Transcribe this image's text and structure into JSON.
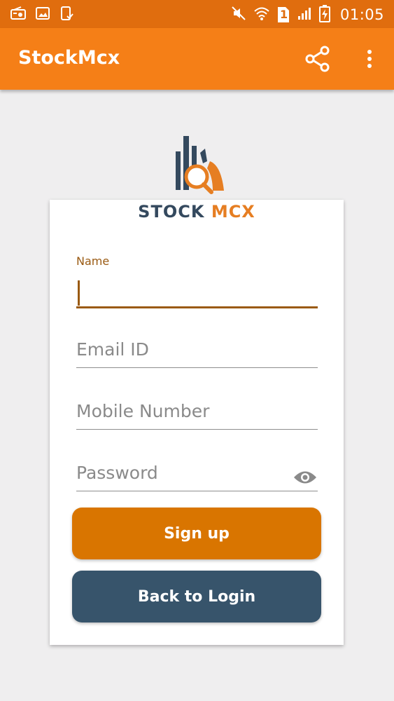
{
  "status_bar": {
    "time": "01:05",
    "sim_slot": "1",
    "icons": [
      "radio-icon",
      "image-icon",
      "phone-check-icon",
      "mute-icon",
      "wifi-icon",
      "sim-icon",
      "signal-icon",
      "battery-charging-icon"
    ]
  },
  "toolbar": {
    "title": "StockMcx",
    "share_icon": "share-icon",
    "more_icon": "more-vert-icon"
  },
  "brand": {
    "word1": "STOCK",
    "word2": "MCX"
  },
  "form": {
    "name_label": "Name",
    "name_value": "",
    "email_placeholder": "Email ID",
    "mobile_placeholder": "Mobile Number",
    "password_placeholder": "Password",
    "password_toggle_icon": "eye-icon"
  },
  "buttons": {
    "signup": "Sign up",
    "back_to_login": "Back to Login"
  },
  "colors": {
    "status_bar": "#e06d0e",
    "toolbar": "#f57f17",
    "accent": "#9a5a12",
    "signup_button": "#d97500",
    "login_button": "#37546b",
    "background": "#efeeef"
  }
}
